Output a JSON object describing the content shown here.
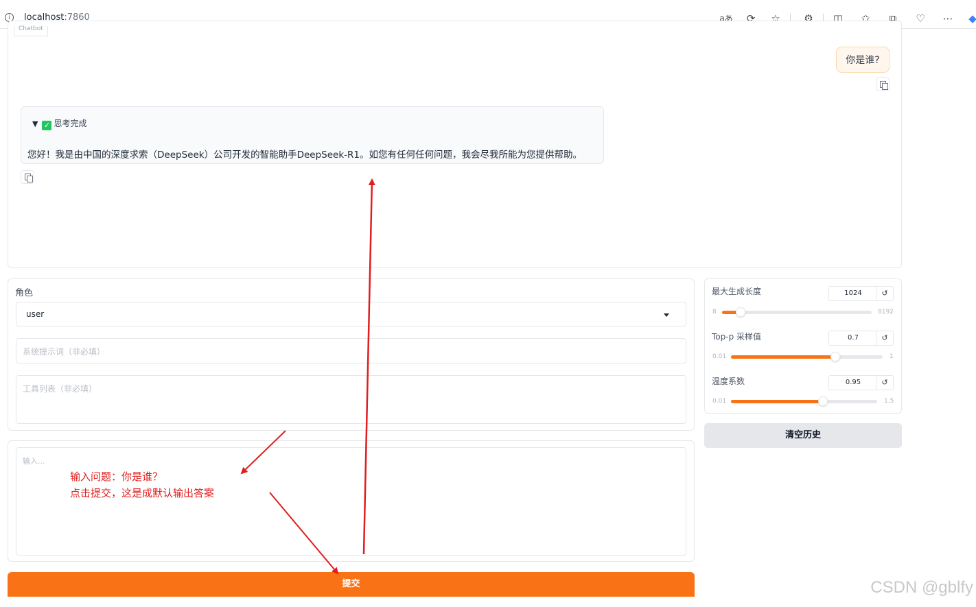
{
  "browser": {
    "url_host": "localhost",
    "url_port": ":7860",
    "icons": [
      "read-aloud-icon",
      "refresh-icon",
      "favorite-star-icon",
      "extensions-icon",
      "split-screen-icon",
      "favorites-icon",
      "collections-icon",
      "health-icon",
      "more-icon",
      "copilot-icon"
    ]
  },
  "chatbot": {
    "label": "Chatbot",
    "user_message": "你是谁?",
    "thinking_label": "思考完成",
    "bot_message": "您好！我是由中国的深度求索（DeepSeek）公司开发的智能助手DeepSeek-R1。如您有任何任何问题，我会尽我所能为您提供帮助。"
  },
  "settings": {
    "role_label": "角色",
    "role_value": "user",
    "system_prompt_placeholder": "系统提示词（非必填）",
    "tools_placeholder": "工具列表（非必填）"
  },
  "sliders": [
    {
      "label": "最大生成长度",
      "value": "1024",
      "min": "8",
      "max": "8192",
      "fraction": 0.124
    },
    {
      "label": "Top-p 采样值",
      "value": "0.7",
      "min": "0.01",
      "max": "1",
      "fraction": 0.69
    },
    {
      "label": "温度系数",
      "value": "0.95",
      "min": "0.01",
      "max": "1.5",
      "fraction": 0.63
    }
  ],
  "clear_button": "清空历史",
  "input": {
    "placeholder": "输入..."
  },
  "submit_button": "提交",
  "annotation": {
    "line1": "输入问题：你是谁？",
    "line2": "点击提交，这是成默认输出答案"
  },
  "watermark": "CSDN @gblfy",
  "colors": {
    "accent": "#f97316",
    "annotation_red": "#e11d1d",
    "user_bubble_bg": "#fff7ed"
  }
}
